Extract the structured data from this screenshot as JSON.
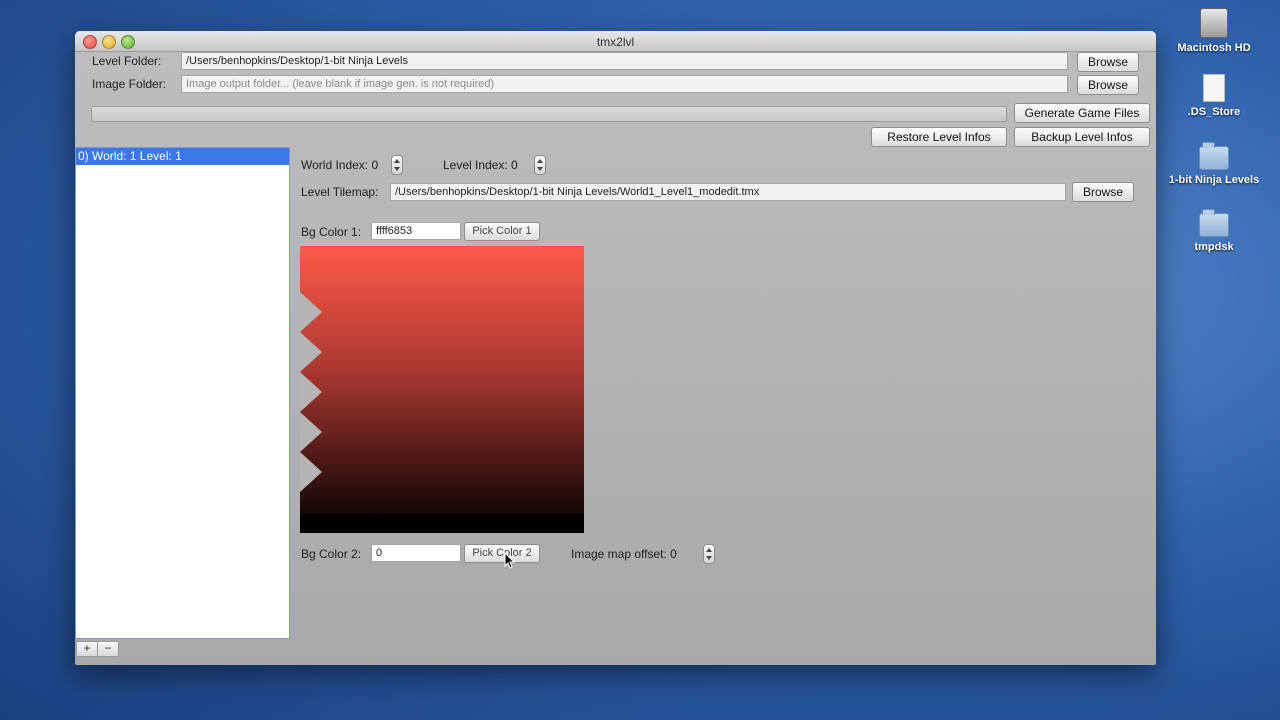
{
  "window": {
    "title": "tmx2lvl"
  },
  "form": {
    "level_folder_label": "Level Folder:",
    "level_folder_value": "/Users/benhopkins/Desktop/1-bit Ninja Levels",
    "image_folder_label": "Image Folder:",
    "image_folder_placeholder": "Image output folder... (leave blank if image gen. is not required)",
    "browse_label": "Browse",
    "generate_label": "Generate Game Files",
    "restore_label": "Restore Level Infos",
    "backup_label": "Backup Level Infos",
    "progress": 0
  },
  "levels": {
    "items": [
      "0)  World: 1 Level: 1"
    ],
    "add_label": "+",
    "remove_label": "−"
  },
  "detail": {
    "world_index_label": "World Index: 0",
    "level_index_label": "Level Index: 0",
    "level_tilemap_label": "Level Tilemap:",
    "level_tilemap_value": "/Users/benhopkins/Desktop/1-bit Ninja Levels/World1_Level1_modedit.tmx",
    "browse_label": "Browse",
    "bg_color1_label": "Bg Color 1:",
    "bg_color1_value": "ffff6853",
    "pick_color1_label": "Pick Color 1",
    "bg_color2_label": "Bg Color 2:",
    "bg_color2_value": "0",
    "pick_color2_label": "Pick Color 2",
    "image_map_offset_label": "Image map offset: 0",
    "gradient_top": "#ff5a48",
    "gradient_bottom": "#000000"
  },
  "desktop": {
    "icons": [
      {
        "name": "hard-drive-icon",
        "label": "Macintosh HD"
      },
      {
        "name": "file-icon",
        "label": ".DS_Store"
      },
      {
        "name": "folder-icon",
        "label": "1-bit Ninja Levels"
      },
      {
        "name": "folder-icon",
        "label": "tmpdsk"
      }
    ]
  }
}
